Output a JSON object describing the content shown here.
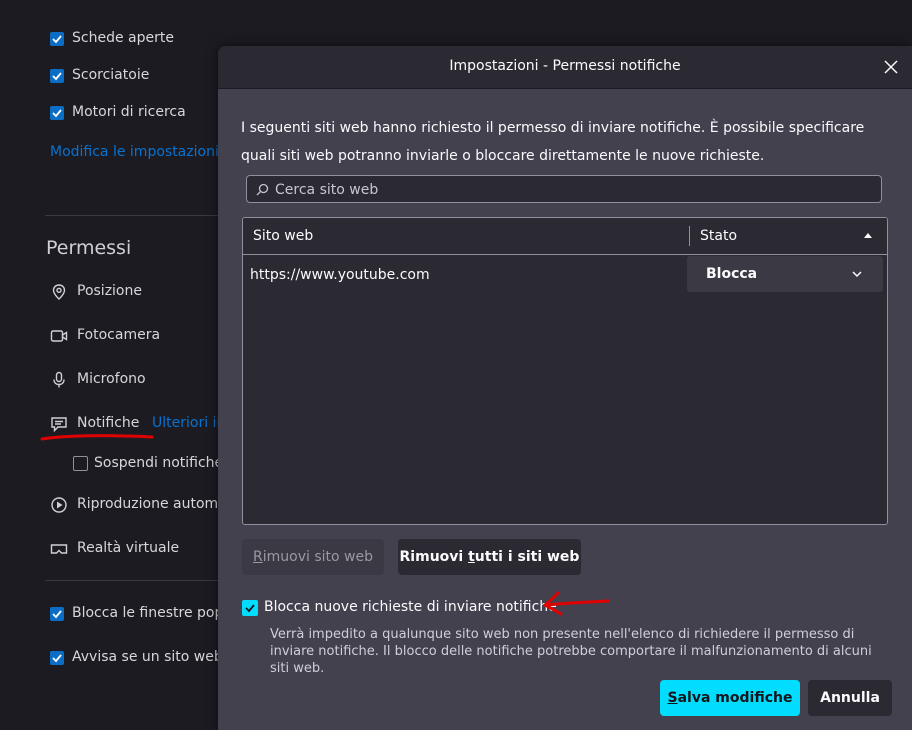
{
  "background": {
    "checkboxes": [
      {
        "label": "Schede aperte",
        "checked": true
      },
      {
        "label": "Scorciatoie",
        "checked": true
      },
      {
        "label": "Motori di ricerca",
        "checked": true
      }
    ],
    "modify_link": "Modifica le impostazioni",
    "permissions_title": "Permessi",
    "permissions": [
      {
        "label": "Posizione",
        "icon": "location-icon"
      },
      {
        "label": "Fotocamera",
        "icon": "camera-icon"
      },
      {
        "label": "Microfono",
        "icon": "microphone-icon"
      },
      {
        "label": "Notifiche",
        "icon": "notification-icon"
      },
      {
        "label": "Riproduzione automa",
        "icon": "autoplay-icon"
      },
      {
        "label": "Realtà virtuale",
        "icon": "vr-icon"
      }
    ],
    "notifications_link": "Ulteriori in",
    "suspend_label": "Sospendi notifiche",
    "bottom_checkboxes": [
      {
        "label": "Blocca le finestre pop-",
        "checked": true
      },
      {
        "label": "Avvisa se un sito web c",
        "checked": true
      }
    ]
  },
  "dialog": {
    "title": "Impostazioni - Permessi notifiche",
    "description": "I seguenti siti web hanno richiesto il permesso di inviare notifiche. È possibile specificare quali siti web potranno inviarle o bloccare direttamente le nuove richieste.",
    "search_placeholder": "Cerca sito web",
    "table": {
      "col_site": "Sito web",
      "col_status": "Stato",
      "rows": [
        {
          "site": "https://www.youtube.com",
          "status": "Blocca"
        }
      ]
    },
    "remove_site_btn": {
      "u": "R",
      "rest": "imuovi sito web"
    },
    "remove_all_btn": {
      "pre": "Rimuovi ",
      "u": "t",
      "rest": "utti i siti web"
    },
    "block_checkbox": {
      "checked": true,
      "label": "Blocca nuove richieste di inviare notifiche"
    },
    "block_description": "Verrà impedito a qualunque sito web non presente nell'elenco di richiedere il permesso di inviare notifiche. Il blocco delle notifiche potrebbe comportare il malfunzionamento di alcuni siti web.",
    "save_btn": {
      "u": "S",
      "rest": "alva modifiche"
    },
    "cancel_btn": "Annulla"
  },
  "colors": {
    "accent": "#00ddff",
    "link": "#0a72cf",
    "annotation": "#e00000"
  }
}
